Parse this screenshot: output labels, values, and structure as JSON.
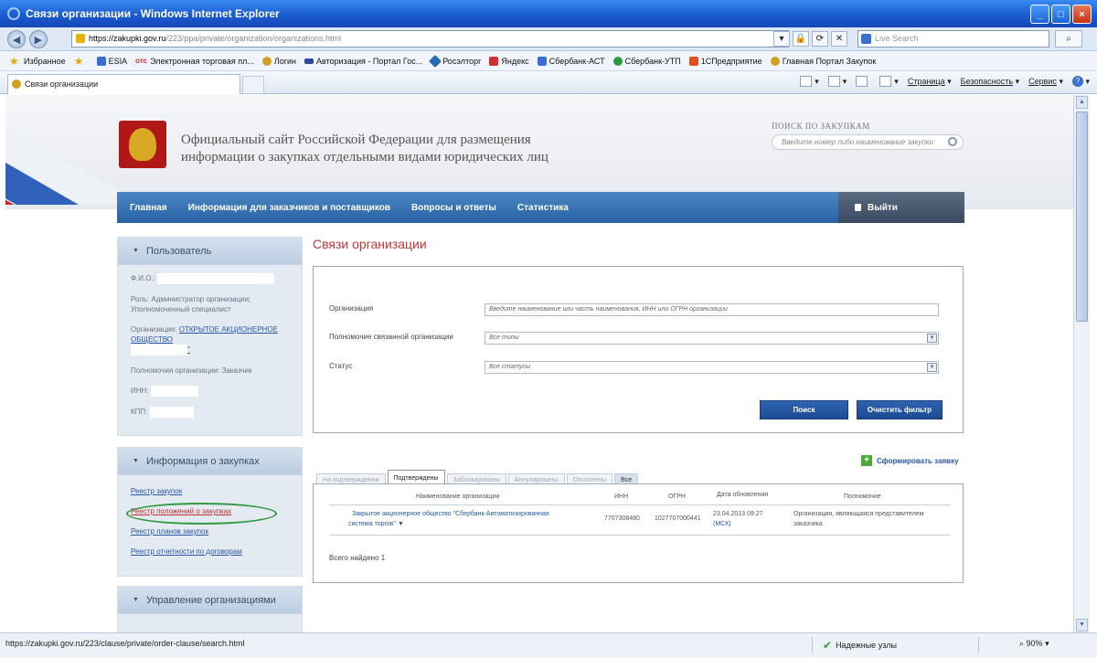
{
  "window": {
    "title": "Связи организации - Windows Internet Explorer",
    "controls": [
      "_",
      "□",
      "×"
    ]
  },
  "address": {
    "url_scheme_host": "https://zakupki.gov.ru",
    "url_path": "/223/ppa/private/organization/organizations.html",
    "live_search_placeholder": "Live Search"
  },
  "favorites": {
    "label": "Избранное",
    "items": [
      {
        "label": "ESIA",
        "color": "#3a6fd0"
      },
      {
        "label": "Электронная торговая пл...",
        "color": "#d03030"
      },
      {
        "label": "Логин",
        "color": "#d4a020"
      },
      {
        "label": "Авторизация - Портал Гос...",
        "color": "#2a4aa0"
      },
      {
        "label": "Росэлторг",
        "color": "#2a6ab0"
      },
      {
        "label": "Яндекс",
        "color": "#d03030"
      },
      {
        "label": "Сбербанк-АСТ",
        "color": "#3a6fd0"
      },
      {
        "label": "Сбербанк-УТП",
        "color": "#2e9a3e"
      },
      {
        "label": "1СПредприятие",
        "color": "#e05020"
      },
      {
        "label": "Главная Портал Закупок",
        "color": "#d4a020"
      }
    ],
    "otc_prefix": "отс"
  },
  "browser_tab": {
    "label": "Связи организации"
  },
  "command_bar": {
    "page": "Страница",
    "security": "Безопасность",
    "service": "Сервис"
  },
  "site": {
    "title_line1": "Официальный сайт Российской Федерации для размещения",
    "title_line2": "информации о закупках отдельными видами юридических лиц",
    "search_label": "ПОИСК ПО ЗАКУПКАМ",
    "search_placeholder": "Введите номер либо наименование закупки"
  },
  "nav": {
    "items": [
      "Главная",
      "Информация для заказчиков и поставщиков",
      "Вопросы и ответы",
      "Статистика"
    ],
    "logout": "Выйти"
  },
  "user_panel": {
    "title": "Пользователь",
    "fio_label": "Ф.И.О.:",
    "role": "Роль: Администратор организации; Уполномоченный специалист",
    "org_label": "Организация:",
    "org_link": "ОТКРЫТОЕ АКЦИОНЕРНОЕ ОБЩЕСТВО",
    "org_link_tail": "\"",
    "powers": "Полномочия организации: Заказчик",
    "inn_label": "ИНН:",
    "kpp_label": "КПП:"
  },
  "info_panel": {
    "title": "Информация о закупках",
    "links": [
      "Реестр закупок",
      "Реестр положений о закупках",
      "Реестр планов закупок",
      "Реестр отчетности по договорам"
    ]
  },
  "org_panel": {
    "title": "Управление организациями"
  },
  "main": {
    "page_title": "Связи организации",
    "filter": {
      "org_label": "Организация",
      "org_placeholder": "Введите наименование или часть наименования, ИНН или ОГРН организации",
      "powers_label": "Полномочие связанной организации",
      "powers_value": "Все типы",
      "status_label": "Статус",
      "status_value": "Все статусы",
      "search_button": "Поиск",
      "clear_button": "Очистить фильтр"
    },
    "form_request": "Сформировать заявку",
    "tabs": [
      "На подтверждении",
      "Подтверждены",
      "Заблокированы",
      "Аннулированы",
      "Отклонены",
      "Все"
    ],
    "columns": [
      "Наименование организации",
      "ИНН",
      "ОГРН",
      "Дата обновления",
      "Полномочие"
    ],
    "rows": [
      {
        "name_line1": "Закрытое акционерное общество \"Сбербанк-Автоматизированная",
        "name_line2": "система торгов\"",
        "inn": "7707308480",
        "ogrn": "1027707000441",
        "date_line1": "23.04.2013 09:27",
        "date_line2": "(МСК)",
        "power_line1": "Организация, являющаяся представителем",
        "power_line2": "заказчика"
      }
    ],
    "total": "Всего найдено 1"
  },
  "status": {
    "url": "https://zakupki.gov.ru/223/clause/private/order-clause/search.html",
    "zone": "Надежные узлы",
    "zoom": "90%"
  }
}
